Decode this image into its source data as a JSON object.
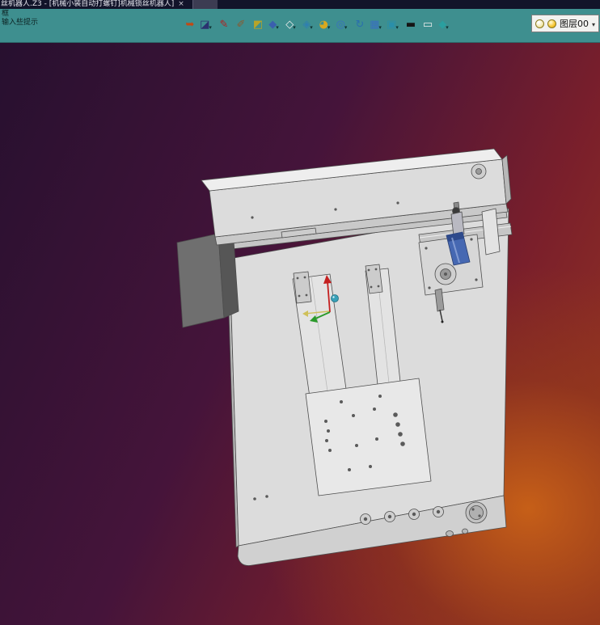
{
  "window": {
    "title": "丝机器人.Z3 - [机械小装自动打螺钉]机械锁丝机器人]",
    "close_label": "×"
  },
  "prompt": {
    "line1": "框",
    "line2": "输入些提示"
  },
  "toolbar": {
    "dropdown_glyph": "▾",
    "icons": [
      {
        "name": "exit-icon",
        "glyph": "➥",
        "color": "#c24914",
        "dropdown": false
      },
      {
        "name": "export-icon",
        "glyph": "◪",
        "color": "#2b3270",
        "dropdown": true
      },
      {
        "name": "pencil-icon",
        "glyph": "✎",
        "color": "#b22020",
        "dropdown": false
      },
      {
        "name": "brush-icon",
        "glyph": "✐",
        "color": "#8a5a30",
        "dropdown": false
      },
      {
        "name": "cube-yellow-icon",
        "glyph": "◩",
        "color": "#b8a428",
        "dropdown": false
      },
      {
        "name": "cube-blue-icon",
        "glyph": "◆",
        "color": "#3a5fae",
        "dropdown": true
      },
      {
        "name": "cube-white-icon",
        "glyph": "◇",
        "color": "#eeeeee",
        "dropdown": true
      },
      {
        "name": "cube-teal-icon",
        "glyph": "◈",
        "color": "#2f7fb0",
        "dropdown": true
      },
      {
        "name": "sphere-yellow-icon",
        "glyph": "◕",
        "color": "#d8a820",
        "dropdown": true
      },
      {
        "name": "zoom-icon",
        "glyph": "◎",
        "color": "#3a6fc0",
        "dropdown": true
      },
      {
        "name": "refresh-icon",
        "glyph": "↻",
        "color": "#2a6fae",
        "dropdown": false
      },
      {
        "name": "grid-plane-icon",
        "glyph": "▦",
        "color": "#3a6fc0",
        "dropdown": true
      },
      {
        "name": "display-icon",
        "glyph": "▣",
        "color": "#2a8faa",
        "dropdown": true
      },
      {
        "name": "black-rect-icon",
        "glyph": "▬",
        "color": "#151515",
        "dropdown": false
      },
      {
        "name": "white-rect-icon",
        "glyph": "▭",
        "color": "#ececec",
        "dropdown": false
      },
      {
        "name": "cube-cyan-icon",
        "glyph": "◆",
        "color": "#2a9f9f",
        "dropdown": true
      }
    ],
    "layer": {
      "label": "图层00",
      "dropdown_glyph": "▾"
    }
  },
  "colors": {
    "titlebar-bg": "#12142a",
    "toolbar-bg": "#3e8f8f",
    "vp1": "#27102f",
    "vp2": "#45143a",
    "vp3": "#7a1f2b",
    "vp4": "#9c3a1f",
    "vp-glow": "#c65f18",
    "machine-body": "#d9d9d9",
    "machine-outline": "#4d4d4d",
    "spindle-blue": "#4668b2",
    "triad-red": "#c42020",
    "triad-green": "#2a9a2a",
    "triad-yellow": "#cfc05a",
    "triad-teal": "#38a0b8",
    "bulb1": "#f2e9b0",
    "bulb2": "#f6c52e"
  }
}
